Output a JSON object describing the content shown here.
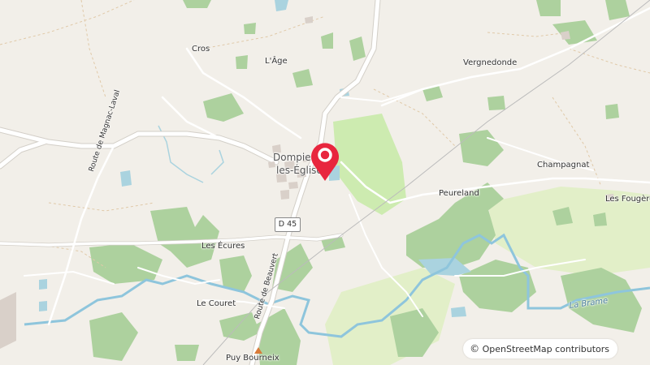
{
  "map": {
    "place_labels": [
      {
        "id": "cros",
        "text": "Cros"
      },
      {
        "id": "lage",
        "text": "L'Âge"
      },
      {
        "id": "vergnedonde",
        "text": "Vergnedonde"
      },
      {
        "id": "dompierre1",
        "text": "Dompierre-"
      },
      {
        "id": "dompierre2",
        "text": "les-Églises"
      },
      {
        "id": "champagnat",
        "text": "Champagnat"
      },
      {
        "id": "peureland",
        "text": "Peureland"
      },
      {
        "id": "lesfougeres",
        "text": "Les Fougères"
      },
      {
        "id": "lesecures",
        "text": "Les Écures"
      },
      {
        "id": "lecouret",
        "text": "Le Couret"
      },
      {
        "id": "puybourneix",
        "text": "Puy Bourneix"
      }
    ],
    "road_labels": {
      "d45": "D 45",
      "magnac": "Route de Magnac-Laval",
      "beauvert": "Route de Beauvert",
      "brame": "La Brame"
    },
    "attribution": {
      "symbol": "©",
      "text": "OpenStreetMap contributors"
    },
    "marker": {
      "icon": "location-pin-icon",
      "color": "#e8263e"
    },
    "colors": {
      "background": "#f2efe9",
      "forest": "#add19e",
      "meadow": "#cdebb0",
      "water": "#aad3df",
      "river": "#8ec5dc",
      "road": "#ffffff",
      "roadEdge": "#d3cfc8"
    }
  }
}
